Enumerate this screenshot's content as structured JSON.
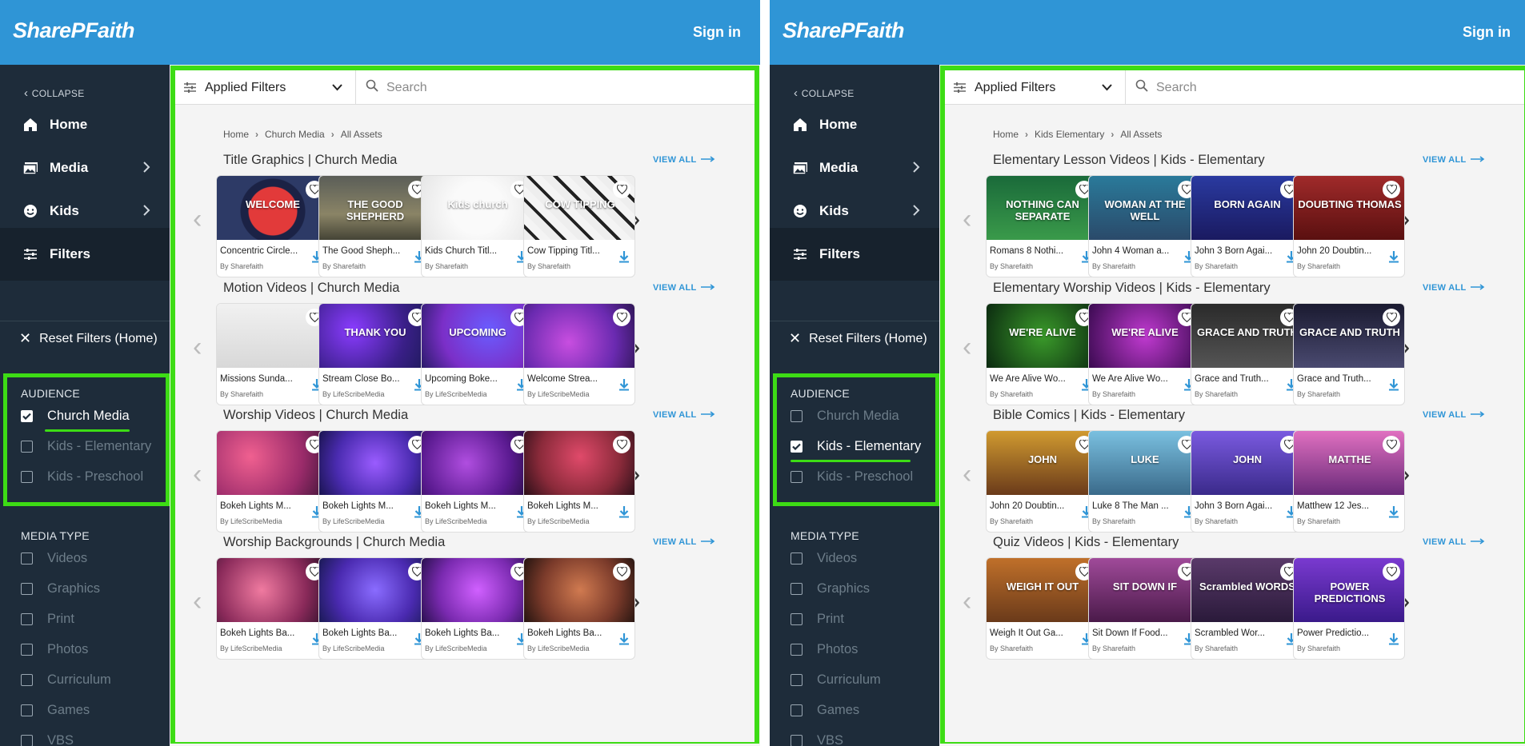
{
  "colors": {
    "accent": "#2f95d6",
    "highlight": "#3ddc15",
    "sidebar": "#1e2c3a"
  },
  "panels": [
    {
      "logo": "SharePFaith",
      "sign_in": "Sign in",
      "sidebar": {
        "collapse": "COLLAPSE",
        "nav": [
          {
            "label": "Home",
            "icon": "home-icon"
          },
          {
            "label": "Media",
            "icon": "media-icon"
          },
          {
            "label": "Kids",
            "icon": "kids-icon"
          },
          {
            "label": "Filters",
            "icon": "filters-icon"
          }
        ],
        "reset": "Reset Filters (Home)",
        "audience_title": "AUDIENCE",
        "audience": [
          {
            "label": "Church Media",
            "checked": true
          },
          {
            "label": "Kids - Elementary",
            "checked": false
          },
          {
            "label": "Kids - Preschool",
            "checked": false
          }
        ],
        "media_type_title": "MEDIA TYPE",
        "media_types": [
          {
            "label": "Videos"
          },
          {
            "label": "Graphics"
          },
          {
            "label": "Print"
          },
          {
            "label": "Photos"
          },
          {
            "label": "Curriculum"
          },
          {
            "label": "Games"
          },
          {
            "label": "VBS"
          }
        ]
      },
      "toolbar": {
        "applied": "Applied Filters",
        "search_placeholder": "Search"
      },
      "breadcrumb": [
        "Home",
        "Church Media",
        "All Assets"
      ],
      "view_all": "VIEW ALL",
      "sections": [
        {
          "title": "Title Graphics | Church Media",
          "cards": [
            {
              "name": "Concentric Circle...",
              "by": "By Sharefaith",
              "thumb": "WELCOME"
            },
            {
              "name": "The Good Sheph...",
              "by": "By Sharefaith",
              "thumb": "THE GOOD SHEPHERD"
            },
            {
              "name": "Kids Church Titl...",
              "by": "By Sharefaith",
              "thumb": "Kids church"
            },
            {
              "name": "Cow Tipping Titl...",
              "by": "By Sharefaith",
              "thumb": "COW TIPPING"
            }
          ]
        },
        {
          "title": "Motion Videos | Church Media",
          "cards": [
            {
              "name": "Missions Sunda...",
              "by": "By Sharefaith",
              "thumb": ""
            },
            {
              "name": "Stream Close Bo...",
              "by": "By LifeScribeMedia",
              "thumb": "THANK YOU"
            },
            {
              "name": "Upcoming Boke...",
              "by": "By LifeScribeMedia",
              "thumb": "UPCOMING"
            },
            {
              "name": "Welcome Strea...",
              "by": "By LifeScribeMedia",
              "thumb": ""
            }
          ]
        },
        {
          "title": "Worship Videos | Church Media",
          "cards": [
            {
              "name": "Bokeh Lights M...",
              "by": "By LifeScribeMedia",
              "thumb": ""
            },
            {
              "name": "Bokeh Lights M...",
              "by": "By LifeScribeMedia",
              "thumb": ""
            },
            {
              "name": "Bokeh Lights M...",
              "by": "By LifeScribeMedia",
              "thumb": ""
            },
            {
              "name": "Bokeh Lights M...",
              "by": "By LifeScribeMedia",
              "thumb": ""
            }
          ]
        },
        {
          "title": "Worship Backgrounds | Church Media",
          "cards": [
            {
              "name": "Bokeh Lights Ba...",
              "by": "By LifeScribeMedia",
              "thumb": ""
            },
            {
              "name": "Bokeh Lights Ba...",
              "by": "By LifeScribeMedia",
              "thumb": ""
            },
            {
              "name": "Bokeh Lights Ba...",
              "by": "By LifeScribeMedia",
              "thumb": ""
            },
            {
              "name": "Bokeh Lights Ba...",
              "by": "By LifeScribeMedia",
              "thumb": ""
            }
          ]
        }
      ]
    },
    {
      "logo": "SharePFaith",
      "sign_in": "Sign in",
      "sidebar": {
        "collapse": "COLLAPSE",
        "nav": [
          {
            "label": "Home",
            "icon": "home-icon"
          },
          {
            "label": "Media",
            "icon": "media-icon"
          },
          {
            "label": "Kids",
            "icon": "kids-icon"
          },
          {
            "label": "Filters",
            "icon": "filters-icon"
          }
        ],
        "reset": "Reset Filters (Home)",
        "audience_title": "AUDIENCE",
        "audience": [
          {
            "label": "Church Media",
            "checked": false
          },
          {
            "label": "Kids - Elementary",
            "checked": true
          },
          {
            "label": "Kids - Preschool",
            "checked": false
          }
        ],
        "media_type_title": "MEDIA TYPE",
        "media_types": [
          {
            "label": "Videos"
          },
          {
            "label": "Graphics"
          },
          {
            "label": "Print"
          },
          {
            "label": "Photos"
          },
          {
            "label": "Curriculum"
          },
          {
            "label": "Games"
          },
          {
            "label": "VBS"
          }
        ]
      },
      "toolbar": {
        "applied": "Applied Filters",
        "search_placeholder": "Search"
      },
      "breadcrumb": [
        "Home",
        "Kids Elementary",
        "All Assets"
      ],
      "view_all": "VIEW ALL",
      "sections": [
        {
          "title": "Elementary Lesson Videos | Kids - Elementary",
          "cards": [
            {
              "name": "Romans 8 Nothi...",
              "by": "By Sharefaith",
              "thumb": "NOTHING CAN SEPARATE"
            },
            {
              "name": "John 4 Woman a...",
              "by": "By Sharefaith",
              "thumb": "WOMAN AT THE WELL"
            },
            {
              "name": "John 3 Born Agai...",
              "by": "By Sharefaith",
              "thumb": "BORN AGAIN"
            },
            {
              "name": "John 20 Doubtin...",
              "by": "By Sharefaith",
              "thumb": "DOUBTING THOMAS"
            }
          ]
        },
        {
          "title": "Elementary Worship Videos | Kids - Elementary",
          "cards": [
            {
              "name": "We Are Alive Wo...",
              "by": "By Sharefaith",
              "thumb": "WE'RE ALIVE"
            },
            {
              "name": "We Are Alive Wo...",
              "by": "By Sharefaith",
              "thumb": "WE'RE ALIVE"
            },
            {
              "name": "Grace and Truth...",
              "by": "By Sharefaith",
              "thumb": "GRACE AND TRUTH"
            },
            {
              "name": "Grace and Truth...",
              "by": "By Sharefaith",
              "thumb": "GRACE AND TRUTH"
            }
          ]
        },
        {
          "title": "Bible Comics | Kids - Elementary",
          "cards": [
            {
              "name": "John 20 Doubtin...",
              "by": "By Sharefaith",
              "thumb": "JOHN"
            },
            {
              "name": "Luke 8 The Man ...",
              "by": "By Sharefaith",
              "thumb": "LUKE"
            },
            {
              "name": "John 3 Born Agai...",
              "by": "By Sharefaith",
              "thumb": "JOHN"
            },
            {
              "name": "Matthew 12 Jes...",
              "by": "By Sharefaith",
              "thumb": "MATTHE"
            }
          ]
        },
        {
          "title": "Quiz Videos | Kids - Elementary",
          "cards": [
            {
              "name": "Weigh It Out Ga...",
              "by": "By Sharefaith",
              "thumb": "WEIGH IT OUT"
            },
            {
              "name": "Sit Down If Food...",
              "by": "By Sharefaith",
              "thumb": "SIT DOWN IF"
            },
            {
              "name": "Scrambled Wor...",
              "by": "By Sharefaith",
              "thumb": "Scrambled WORDS"
            },
            {
              "name": "Power Predictio...",
              "by": "By Sharefaith",
              "thumb": "POWER PREDICTIONS"
            }
          ]
        }
      ]
    }
  ]
}
